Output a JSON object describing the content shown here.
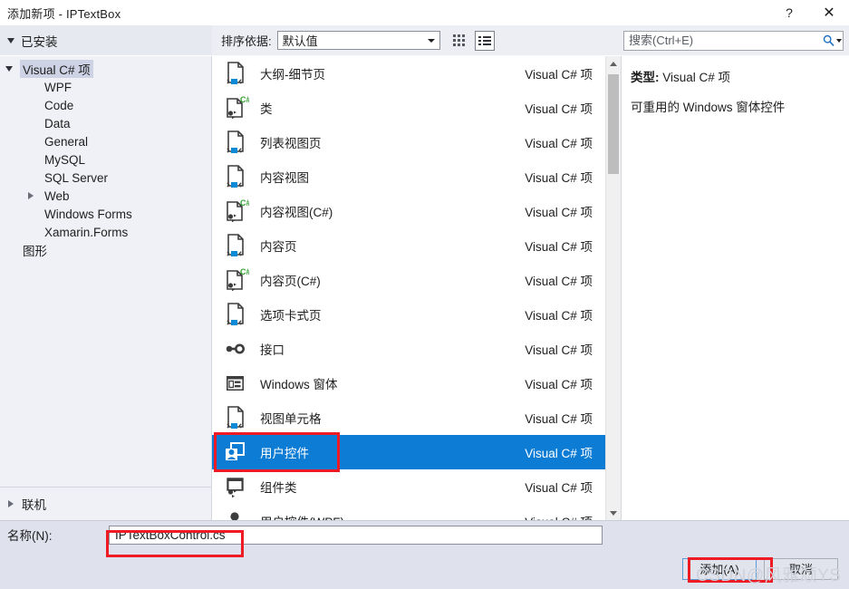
{
  "window": {
    "title": "添加新项 - IPTextBox",
    "help_label": "?",
    "close_label": "✕"
  },
  "toolbar": {
    "installed_label": "已安装",
    "sort_label": "排序依据:",
    "sort_value": "默认值",
    "grid_view_name": "grid-view",
    "list_view_name": "list-view"
  },
  "search": {
    "placeholder": "搜索(Ctrl+E)",
    "value": ""
  },
  "sidebar": {
    "groups": [
      {
        "label": "Visual C# 项",
        "level": 1,
        "expanded": true,
        "selected": true,
        "has_caret": true
      },
      {
        "label": "WPF",
        "level": 2,
        "has_caret": false
      },
      {
        "label": "Code",
        "level": 2,
        "has_caret": false
      },
      {
        "label": "Data",
        "level": 2,
        "has_caret": false
      },
      {
        "label": "General",
        "level": 2,
        "has_caret": false
      },
      {
        "label": "MySQL",
        "level": 2,
        "has_caret": false
      },
      {
        "label": "SQL Server",
        "level": 2,
        "has_caret": false
      },
      {
        "label": "Web",
        "level": 2,
        "has_caret": true,
        "expanded": false
      },
      {
        "label": "Windows Forms",
        "level": 2,
        "has_caret": false
      },
      {
        "label": "Xamarin.Forms",
        "level": 2,
        "has_caret": false
      },
      {
        "label": "图形",
        "level": 1,
        "has_caret": false
      }
    ],
    "online_label": "联机"
  },
  "list": {
    "type_column": "Visual C# 项",
    "items": [
      {
        "name": "大纲-细节页",
        "type": "Visual C# 项",
        "icon": "page-icon",
        "selected": false
      },
      {
        "name": "类",
        "type": "Visual C# 项",
        "icon": "class-csharp-icon",
        "selected": false
      },
      {
        "name": "列表视图页",
        "type": "Visual C# 项",
        "icon": "page-icon",
        "selected": false
      },
      {
        "name": "内容视图",
        "type": "Visual C# 项",
        "icon": "page-icon",
        "selected": false
      },
      {
        "name": "内容视图(C#)",
        "type": "Visual C# 项",
        "icon": "class-csharp-icon",
        "selected": false
      },
      {
        "name": "内容页",
        "type": "Visual C# 项",
        "icon": "page-icon",
        "selected": false
      },
      {
        "name": "内容页(C#)",
        "type": "Visual C# 项",
        "icon": "class-csharp-icon",
        "selected": false
      },
      {
        "name": "选项卡式页",
        "type": "Visual C# 项",
        "icon": "page-icon",
        "selected": false
      },
      {
        "name": "接口",
        "type": "Visual C# 项",
        "icon": "interface-icon",
        "selected": false
      },
      {
        "name": "Windows 窗体",
        "type": "Visual C# 项",
        "icon": "windows-form-icon",
        "selected": false
      },
      {
        "name": "视图单元格",
        "type": "Visual C# 项",
        "icon": "page-icon",
        "selected": false
      },
      {
        "name": "用户控件",
        "type": "Visual C# 项",
        "icon": "user-control-icon",
        "selected": true
      },
      {
        "name": "组件类",
        "type": "Visual C# 项",
        "icon": "component-class-icon",
        "selected": false
      },
      {
        "name": "用户控件(WPF)",
        "type": "Visual C# 项",
        "icon": "user-control-wpf-icon",
        "selected": false
      }
    ]
  },
  "info": {
    "type_label": "类型:",
    "type_value": "Visual C# 项",
    "description": "可重用的 Windows 窗体控件"
  },
  "bottom": {
    "name_label": "名称(N):",
    "name_value": "IPTextBoxControl.cs",
    "add_button": "添加(A)",
    "cancel_button": "取消"
  },
  "watermark": {
    "text": "CSDN@风雅颂YS"
  },
  "colors": {
    "selection_blue": "#0c7cd5",
    "annotation_red": "#ee1b24",
    "dialog_chrome": "#dfe2ec",
    "sidebar_bg": "#eff1f6"
  }
}
